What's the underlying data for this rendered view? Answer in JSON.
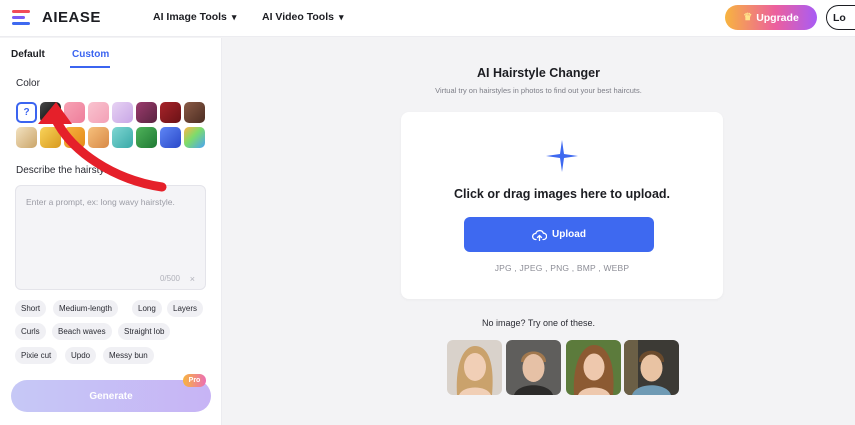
{
  "brand": {
    "name": "AIEASE"
  },
  "nav": {
    "image_tools": "AI Image Tools",
    "video_tools": "AI Video Tools",
    "upgrade": "Upgrade",
    "login": "Lo"
  },
  "sidebar": {
    "tab_default": "Default",
    "tab_custom": "Custom",
    "color_label": "Color",
    "swatch_unknown": "?",
    "describe_label": "Describe the hairstyle",
    "prompt_placeholder": "Enter a prompt, ex: long wavy hairstyle.",
    "prompt_counter": "0/500",
    "prompt_clear": "×",
    "chips": [
      "Short",
      "Medium-length",
      "Long",
      "Layers",
      "Curls",
      "Beach waves",
      "Straight lob",
      "Pixie cut",
      "Updo",
      "Messy bun"
    ],
    "generate": "Generate",
    "pro_badge": "Pro"
  },
  "main": {
    "title": "AI Hairstyle Changer",
    "subtitle": "Virtual try on hairstyles in photos to find out your best haircuts.",
    "upload_prompt": "Click or drag images here to upload.",
    "upload_button": "Upload",
    "formats": "JPG , JPEG , PNG , BMP , WEBP",
    "no_image": "No image? Try one of these."
  },
  "colors": {
    "accent": "#3e69f0",
    "annotation_arrow": "#e5202a"
  },
  "icons": {
    "logo": "aiease-logo-icon",
    "chevron": "chevron-down-icon",
    "crown": "crown-icon",
    "plus": "sparkle-plus-icon",
    "upload": "cloud-upload-icon"
  }
}
